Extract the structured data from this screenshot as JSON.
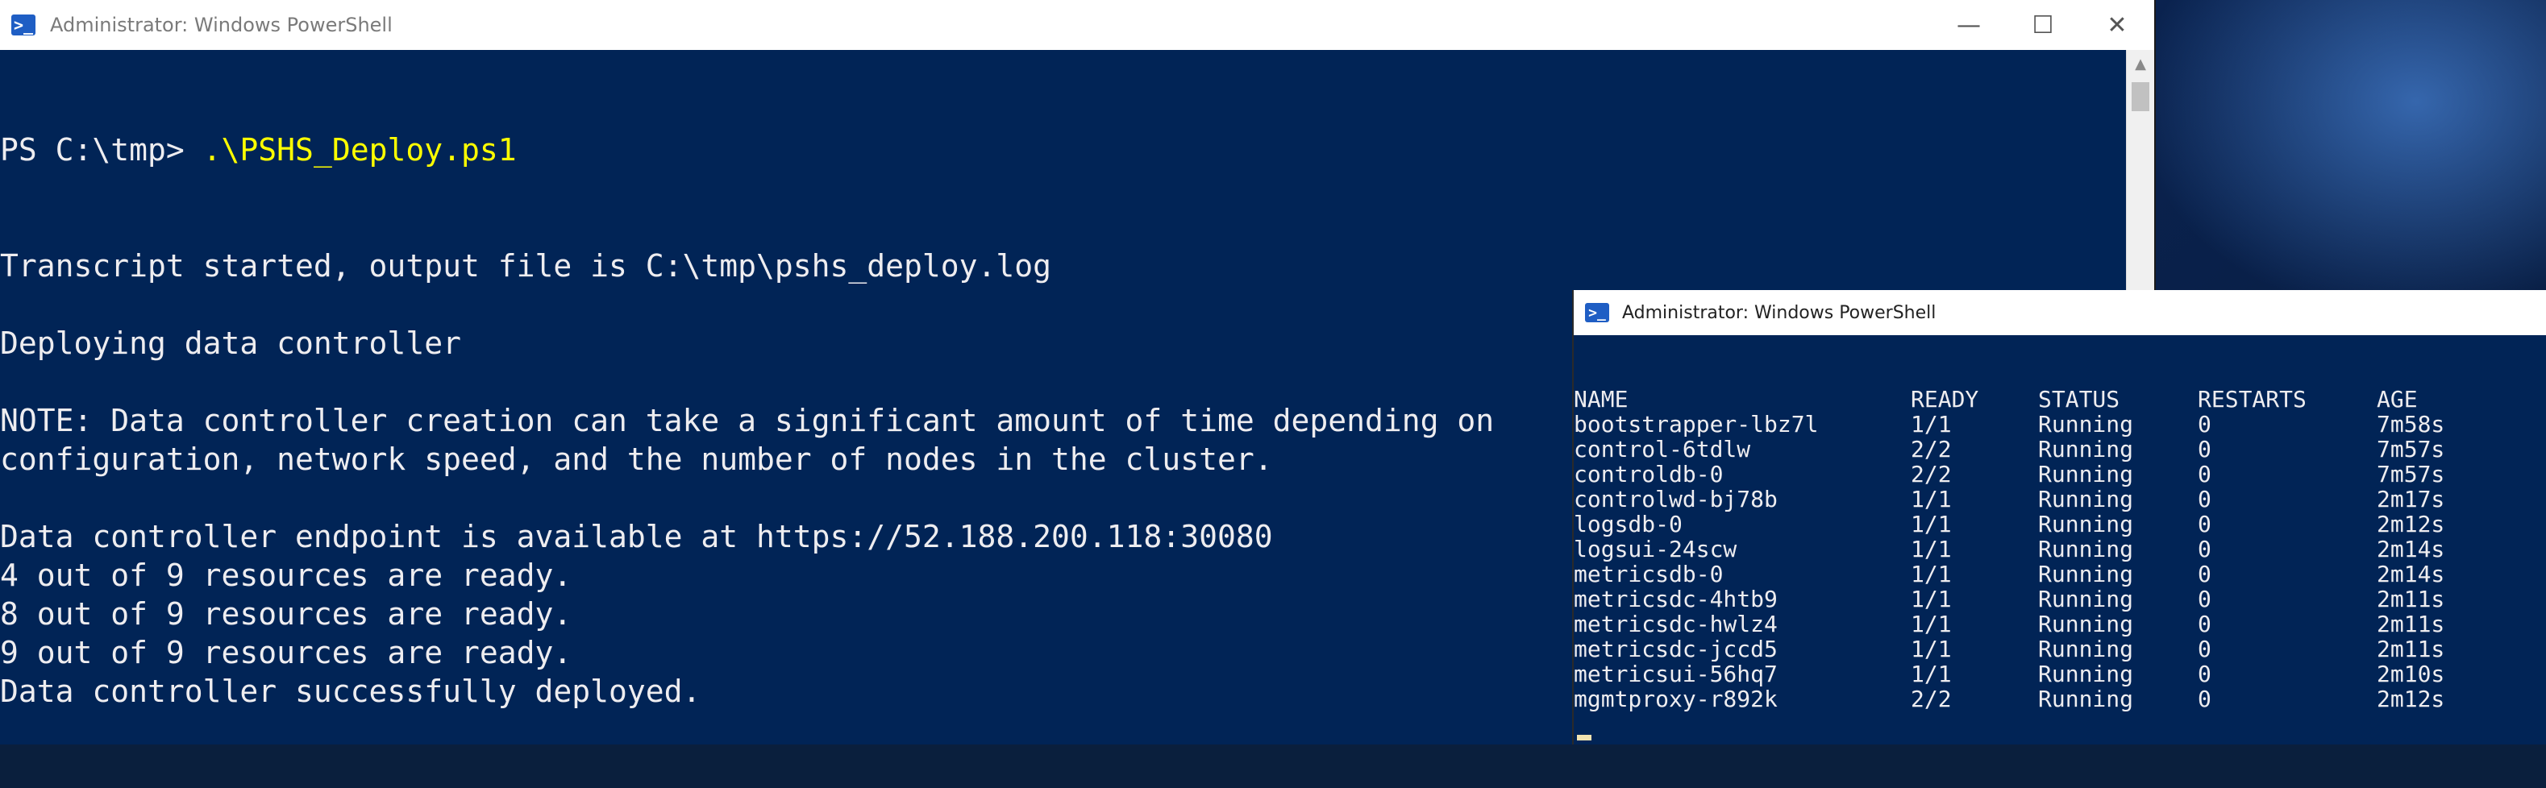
{
  "window_main": {
    "title": "Administrator: Windows PowerShell",
    "icon": "powershell-icon",
    "controls": [
      "minimize-icon",
      "maximize-icon",
      "close-icon"
    ],
    "prompt": "PS C:\\tmp> ",
    "command": ".\\PSHS_Deploy.ps1",
    "lines": [
      "Transcript started, output file is C:\\tmp\\pshs_deploy.log",
      "",
      "Deploying data controller",
      "",
      "NOTE: Data controller creation can take a significant amount of time depending on",
      "configuration, network speed, and the number of nodes in the cluster.",
      "",
      "Data controller endpoint is available at https://52.188.200.118:30080",
      "4 out of 9 resources are ready.",
      "8 out of 9 resources are ready.",
      "9 out of 9 resources are ready.",
      "Data controller successfully deployed."
    ]
  },
  "window_pods": {
    "title": "Administrator: Windows PowerShell",
    "icon": "powershell-icon",
    "headers": {
      "name": "NAME",
      "ready": "READY",
      "status": "STATUS",
      "restarts": "RESTARTS",
      "age": "AGE"
    },
    "rows": [
      {
        "name": "bootstrapper-lbz7l",
        "ready": "1/1",
        "status": "Running",
        "restarts": "0",
        "age": "7m58s"
      },
      {
        "name": "control-6tdlw",
        "ready": "2/2",
        "status": "Running",
        "restarts": "0",
        "age": "7m57s"
      },
      {
        "name": "controldb-0",
        "ready": "2/2",
        "status": "Running",
        "restarts": "0",
        "age": "7m57s"
      },
      {
        "name": "controlwd-bj78b",
        "ready": "1/1",
        "status": "Running",
        "restarts": "0",
        "age": "2m17s"
      },
      {
        "name": "logsdb-0",
        "ready": "1/1",
        "status": "Running",
        "restarts": "0",
        "age": "2m12s"
      },
      {
        "name": "logsui-24scw",
        "ready": "1/1",
        "status": "Running",
        "restarts": "0",
        "age": "2m14s"
      },
      {
        "name": "metricsdb-0",
        "ready": "1/1",
        "status": "Running",
        "restarts": "0",
        "age": "2m14s"
      },
      {
        "name": "metricsdc-4htb9",
        "ready": "1/1",
        "status": "Running",
        "restarts": "0",
        "age": "2m11s"
      },
      {
        "name": "metricsdc-hwlz4",
        "ready": "1/1",
        "status": "Running",
        "restarts": "0",
        "age": "2m11s"
      },
      {
        "name": "metricsdc-jccd5",
        "ready": "1/1",
        "status": "Running",
        "restarts": "0",
        "age": "2m11s"
      },
      {
        "name": "metricsui-56hq7",
        "ready": "1/1",
        "status": "Running",
        "restarts": "0",
        "age": "2m10s"
      },
      {
        "name": "mgmtproxy-r892k",
        "ready": "2/2",
        "status": "Running",
        "restarts": "0",
        "age": "2m12s"
      }
    ]
  },
  "colors": {
    "console_bg": "#012456",
    "console_text": "#eeedf0",
    "command_text": "#ffff00",
    "titlebar_bg": "#ffffff"
  }
}
